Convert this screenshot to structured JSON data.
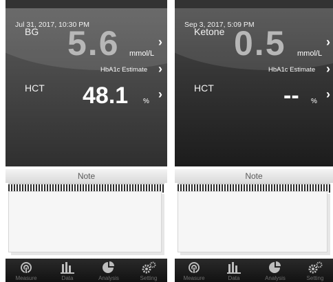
{
  "left": {
    "datetime": "Jul 31, 2017, 10:30 PM",
    "primary_label": "BG",
    "primary_value": "5.6",
    "primary_unit": "mmol/L",
    "hba1c_label": "HbA1c Estimate",
    "hct_label": "HCT",
    "hct_value": "48.1",
    "hct_unit": "%"
  },
  "right": {
    "datetime": "Sep 3, 2017, 5:09 PM",
    "primary_label": "Ketone",
    "primary_value": "0.5",
    "primary_unit": "mmol/L",
    "hba1c_label": "HbA1c Estimate",
    "hct_label": "HCT",
    "hct_value": "--",
    "hct_unit": "%"
  },
  "note": {
    "title": "Note"
  },
  "tabbar": {
    "items": [
      {
        "label": "Measure",
        "icon": "measure-icon"
      },
      {
        "label": "Data",
        "icon": "data-bars-icon"
      },
      {
        "label": "Analysis",
        "icon": "pie-chart-icon"
      },
      {
        "label": "Setting",
        "icon": "gear-icon"
      }
    ]
  },
  "colors": {
    "value_grey": "#b7b7b7",
    "panel_dark": "#1c1c1c",
    "text_white": "#ffffff"
  }
}
